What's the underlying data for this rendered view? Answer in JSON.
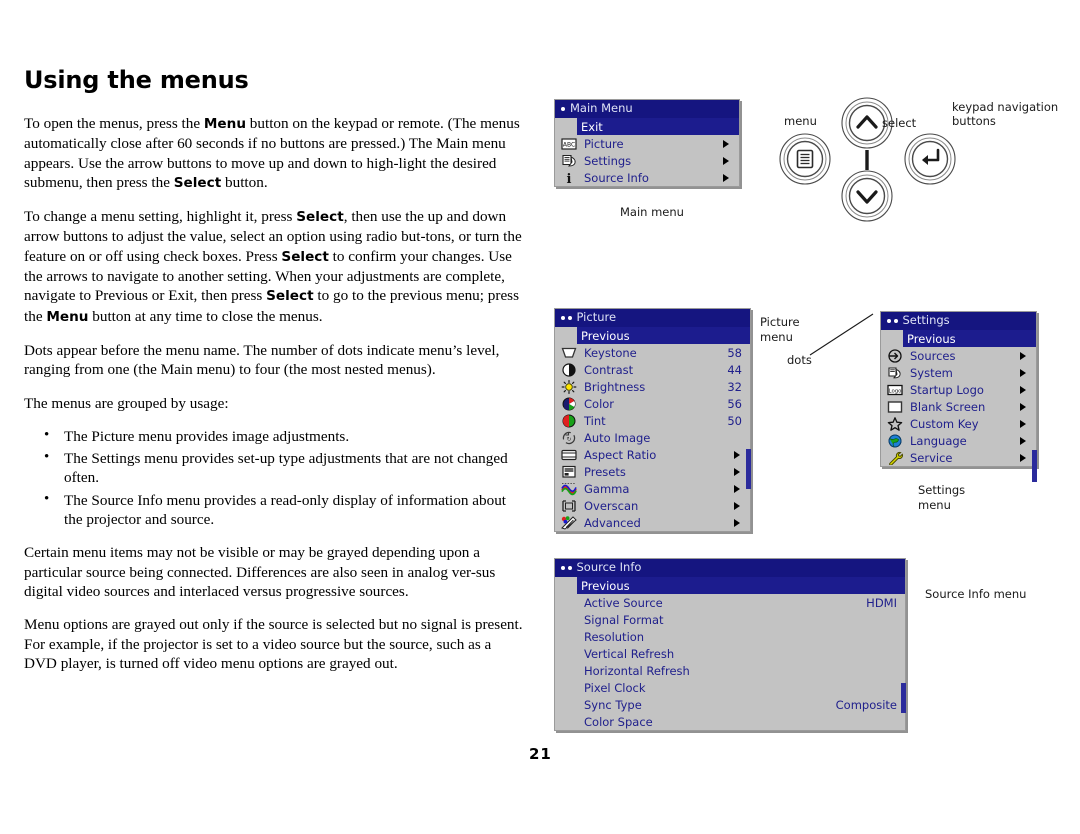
{
  "document": {
    "title": "Using the menus",
    "page_number": "21",
    "paragraphs": [
      {
        "id": "p1",
        "runs": [
          {
            "t": "To open the menus, press the ",
            "b": false
          },
          {
            "t": "Menu",
            "b": true
          },
          {
            "t": " button on the keypad or remote. (The menus automatically close after 60 seconds if no buttons are pressed.) The Main menu appears. Use the arrow buttons to move up and down to high-light the desired submenu, then press the ",
            "b": false
          },
          {
            "t": "Select",
            "b": true
          },
          {
            "t": " button.",
            "b": false
          }
        ]
      },
      {
        "id": "p2",
        "runs": [
          {
            "t": "To change a menu setting, highlight it, press ",
            "b": false
          },
          {
            "t": "Select",
            "b": true
          },
          {
            "t": ", then use the up and down arrow buttons to adjust the value, select an option using radio but-tons, or turn the feature on or off using check boxes. Press ",
            "b": false
          },
          {
            "t": "Select",
            "b": true
          },
          {
            "t": " to confirm your changes. Use the arrows to navigate to another setting. When your adjustments are complete, navigate to Previous or Exit, then press ",
            "b": false
          },
          {
            "t": "Select",
            "b": true
          },
          {
            "t": " to go to the previous menu; press the ",
            "b": false
          },
          {
            "t": "Menu",
            "b": true
          },
          {
            "t": " button at any time to close the menus.",
            "b": false
          }
        ]
      },
      {
        "id": "p3",
        "runs": [
          {
            "t": "Dots appear before the menu name. The number of dots indicate menu’s level, ranging from one (the Main menu) to four (the most nested menus).",
            "b": false
          }
        ]
      },
      {
        "id": "p4",
        "runs": [
          {
            "t": "The menus are grouped by usage:",
            "b": false
          }
        ]
      }
    ],
    "bullets": [
      "The Picture menu provides image adjustments.",
      "The Settings menu provides set-up type adjustments that are not changed often.",
      "The Source Info menu provides a read-only display of information about the projector and source."
    ],
    "paragraphs_after": [
      {
        "id": "p5",
        "runs": [
          {
            "t": "Certain menu items may not be visible or may be grayed depending upon a particular source being connected. Differences are also seen in analog ver-sus digital video sources and interlaced versus progressive sources.",
            "b": false
          }
        ]
      },
      {
        "id": "p6",
        "runs": [
          {
            "t": "Menu options are grayed out only if the source is selected but no signal is present. For example, if the projector is set to a video source but the source, such as a DVD player, is turned off video menu options are grayed out.",
            "b": false
          }
        ]
      }
    ]
  },
  "colors": {
    "osd_body": "#c3c3c3",
    "osd_titlebar": "#151580",
    "osd_selected": "#1c1c8e",
    "osd_text": "#20208c",
    "osd_title_text": "#dfe3f5"
  },
  "main_menu": {
    "title": "Main Menu",
    "dots": 1,
    "caption": "Main menu",
    "rows": [
      {
        "label": "Exit",
        "icon": "none",
        "selected": true,
        "arrow": false,
        "value": ""
      },
      {
        "label": "Picture",
        "icon": "abc-icon",
        "selected": false,
        "arrow": true,
        "value": ""
      },
      {
        "label": "Settings",
        "icon": "pages-icon",
        "selected": false,
        "arrow": true,
        "value": ""
      },
      {
        "label": "Source Info",
        "icon": "info-icon",
        "selected": false,
        "arrow": true,
        "value": ""
      }
    ]
  },
  "picture_menu": {
    "title": "Picture",
    "dots": 2,
    "caption": "Picture\nmenu",
    "dots_callout": "dots",
    "rows": [
      {
        "label": "Previous",
        "icon": "none",
        "selected": true,
        "arrow": false,
        "value": ""
      },
      {
        "label": "Keystone",
        "icon": "keystone-icon",
        "selected": false,
        "arrow": false,
        "value": "58"
      },
      {
        "label": "Contrast",
        "icon": "contrast-icon",
        "selected": false,
        "arrow": false,
        "value": "44"
      },
      {
        "label": "Brightness",
        "icon": "sun-icon",
        "selected": false,
        "arrow": false,
        "value": "32"
      },
      {
        "label": "Color",
        "icon": "color-icon",
        "selected": false,
        "arrow": false,
        "value": "56"
      },
      {
        "label": "Tint",
        "icon": "tint-icon",
        "selected": false,
        "arrow": false,
        "value": "50"
      },
      {
        "label": "Auto Image",
        "icon": "refresh-icon",
        "selected": false,
        "arrow": false,
        "value": ""
      },
      {
        "label": "Aspect Ratio",
        "icon": "aspect-icon",
        "selected": false,
        "arrow": true,
        "value": ""
      },
      {
        "label": "Presets",
        "icon": "presets-icon",
        "selected": false,
        "arrow": true,
        "value": ""
      },
      {
        "label": "Gamma",
        "icon": "gamma-icon",
        "selected": false,
        "arrow": true,
        "value": ""
      },
      {
        "label": "Overscan",
        "icon": "overscan-icon",
        "selected": false,
        "arrow": true,
        "value": ""
      },
      {
        "label": "Advanced",
        "icon": "advanced-icon",
        "selected": false,
        "arrow": true,
        "value": ""
      }
    ]
  },
  "settings_menu": {
    "title": "Settings",
    "dots": 2,
    "caption": "Settings\nmenu",
    "rows": [
      {
        "label": "Previous",
        "icon": "none",
        "selected": true,
        "arrow": false,
        "value": ""
      },
      {
        "label": "Sources",
        "icon": "sources-icon",
        "selected": false,
        "arrow": true,
        "value": ""
      },
      {
        "label": "System",
        "icon": "system-icon",
        "selected": false,
        "arrow": true,
        "value": ""
      },
      {
        "label": "Startup Logo",
        "icon": "logo-icon",
        "selected": false,
        "arrow": true,
        "value": ""
      },
      {
        "label": "Blank Screen",
        "icon": "blank-icon",
        "selected": false,
        "arrow": true,
        "value": ""
      },
      {
        "label": "Custom Key",
        "icon": "star-icon",
        "selected": false,
        "arrow": true,
        "value": ""
      },
      {
        "label": "Language",
        "icon": "globe-icon",
        "selected": false,
        "arrow": true,
        "value": ""
      },
      {
        "label": "Service",
        "icon": "wrench-icon",
        "selected": false,
        "arrow": true,
        "value": ""
      }
    ]
  },
  "source_info_menu": {
    "title": "Source Info",
    "dots": 2,
    "caption": "Source Info menu",
    "rows": [
      {
        "label": "Previous",
        "icon": "none",
        "selected": true,
        "arrow": false,
        "value": ""
      },
      {
        "label": "Active Source",
        "icon": "none",
        "selected": false,
        "arrow": false,
        "value": "HDMI"
      },
      {
        "label": "Signal Format",
        "icon": "none",
        "selected": false,
        "arrow": false,
        "value": ""
      },
      {
        "label": "Resolution",
        "icon": "none",
        "selected": false,
        "arrow": false,
        "value": ""
      },
      {
        "label": "Vertical Refresh",
        "icon": "none",
        "selected": false,
        "arrow": false,
        "value": ""
      },
      {
        "label": "Horizontal Refresh",
        "icon": "none",
        "selected": false,
        "arrow": false,
        "value": ""
      },
      {
        "label": "Pixel Clock",
        "icon": "none",
        "selected": false,
        "arrow": false,
        "value": ""
      },
      {
        "label": "Sync Type",
        "icon": "none",
        "selected": false,
        "arrow": false,
        "value": "Composite"
      },
      {
        "label": "Color Space",
        "icon": "none",
        "selected": false,
        "arrow": false,
        "value": ""
      }
    ]
  },
  "keypad": {
    "menu_label": "menu",
    "select_label": "select",
    "nav_label": "keypad navigation\nbuttons"
  }
}
